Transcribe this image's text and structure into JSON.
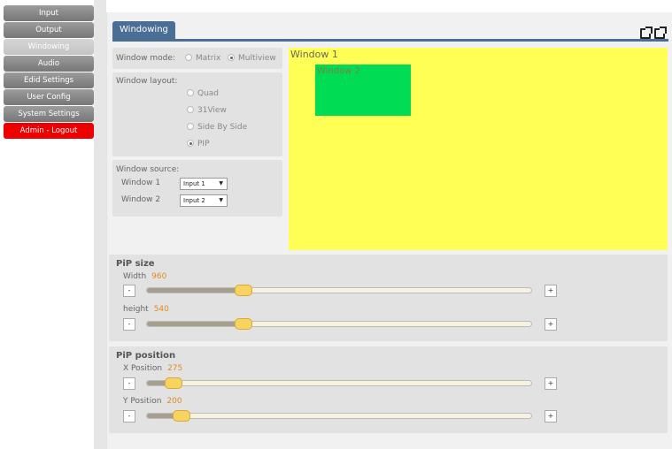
{
  "sidebar": {
    "items": [
      {
        "label": "Input",
        "state": "normal"
      },
      {
        "label": "Output",
        "state": "normal"
      },
      {
        "label": "Windowing",
        "state": "active"
      },
      {
        "label": "Audio",
        "state": "normal"
      },
      {
        "label": "Edid Settings",
        "state": "normal"
      },
      {
        "label": "User Config",
        "state": "normal"
      },
      {
        "label": "System Settings",
        "state": "normal"
      },
      {
        "label": "Admin - Logout",
        "state": "logout"
      }
    ]
  },
  "tab": {
    "label": "Windowing"
  },
  "window_mode": {
    "label": "Window mode:",
    "options": [
      "Matrix",
      "Multiview"
    ],
    "selected": "Multiview"
  },
  "window_layout": {
    "label": "Window layout:",
    "options": [
      "Quad",
      "31View",
      "Side By Side",
      "PIP"
    ],
    "selected": "PIP"
  },
  "window_source": {
    "label": "Window source:",
    "rows": [
      {
        "label": "Window 1",
        "value": "Input 1"
      },
      {
        "label": "Window 2",
        "value": "Input 2"
      }
    ]
  },
  "preview": {
    "window1_label": "Window 1",
    "window2_label": "Window 2"
  },
  "pip_size": {
    "title": "PiP size",
    "sliders": [
      {
        "label": "Width",
        "value": "960",
        "fraction": 0.25
      },
      {
        "label": "height",
        "value": "540",
        "fraction": 0.25
      }
    ]
  },
  "pip_position": {
    "title": "PiP position",
    "sliders": [
      {
        "label": "X Position",
        "value": "275",
        "fraction": 0.07
      },
      {
        "label": "Y Position",
        "value": "200",
        "fraction": 0.09
      }
    ]
  },
  "buttons": {
    "minus": "-",
    "plus": "+"
  },
  "icons": [
    "restore-icon",
    "popout-icon"
  ]
}
